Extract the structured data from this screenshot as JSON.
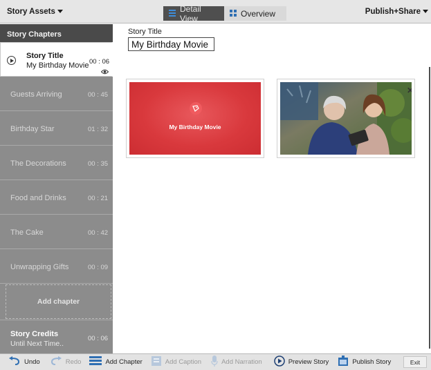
{
  "topbar": {
    "assets_label": "Story Assets",
    "tabs": [
      {
        "label": "Detail View",
        "active": true
      },
      {
        "label": "Overview",
        "active": false
      }
    ],
    "publish_label": "Publish+Share"
  },
  "sidebar": {
    "header": "Story Chapters",
    "active_chapter": {
      "title": "Story Title",
      "subtitle": "My Birthday Movie",
      "duration": "00 : 06"
    },
    "chapters": [
      {
        "label": "Guests Arriving",
        "duration": "00 : 45"
      },
      {
        "label": "Birthday Star",
        "duration": "01 : 32"
      },
      {
        "label": "The Decorations",
        "duration": "00 : 35"
      },
      {
        "label": "Food and Drinks",
        "duration": "00 : 21"
      },
      {
        "label": "The Cake",
        "duration": "00 : 42"
      },
      {
        "label": "Unwrapping Gifts",
        "duration": "00 : 09"
      }
    ],
    "add_chapter_label": "Add chapter",
    "credits": {
      "title": "Story Credits",
      "subtitle": "Until Next Time..",
      "duration": "00 : 06"
    }
  },
  "main": {
    "title_label": "Story Title",
    "title_value": "My Birthday Movie",
    "title_card_text": "My Birthday Movie"
  },
  "toolbar": {
    "undo": "Undo",
    "redo": "Redo",
    "add_chapter": "Add Chapter",
    "add_caption": "Add Caption",
    "add_narration": "Add Narration",
    "preview_story": "Preview Story",
    "publish_story": "Publish Story",
    "exit": "Exit"
  },
  "colors": {
    "accent_blue": "#2f6fb3",
    "title_card_red": "#d9393d",
    "sidebar_gray": "#8c8c8c",
    "header_dark": "#4a4a4a"
  }
}
